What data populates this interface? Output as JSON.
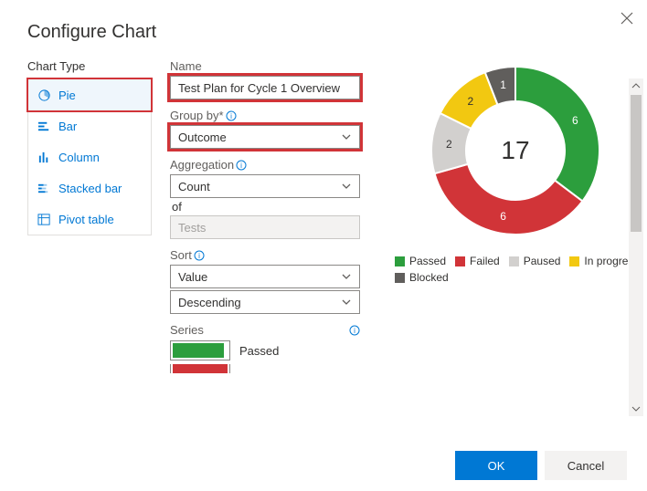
{
  "title": "Configure Chart",
  "chart_type": {
    "label": "Chart Type",
    "items": [
      "Pie",
      "Bar",
      "Column",
      "Stacked bar",
      "Pivot table"
    ],
    "selected_index": 0
  },
  "form": {
    "name_label": "Name",
    "name_value": "Test Plan for Cycle 1 Overview",
    "group_by_label": "Group by*",
    "group_by_value": "Outcome",
    "aggregation_label": "Aggregation",
    "aggregation_value": "Count",
    "of_text": "of",
    "of_value": "Tests",
    "sort_label": "Sort",
    "sort_field": "Value",
    "sort_direction": "Descending",
    "series_label": "Series",
    "series_first_name": "Passed"
  },
  "legend": [
    {
      "name": "Passed",
      "color": "#2c9e3d"
    },
    {
      "name": "Failed",
      "color": "#d13438"
    },
    {
      "name": "Paused",
      "color": "#d2d0ce"
    },
    {
      "name": "In progress",
      "color": "#f2c811"
    },
    {
      "name": "Blocked",
      "color": "#605e5c"
    }
  ],
  "chart_data": {
    "type": "pie",
    "title": "Test Plan for Cycle 1 Overview",
    "total": 17,
    "series": [
      {
        "name": "Passed",
        "value": 6,
        "color": "#2c9e3d"
      },
      {
        "name": "Failed",
        "value": 6,
        "color": "#d13438"
      },
      {
        "name": "Paused",
        "value": 2,
        "color": "#d2d0ce"
      },
      {
        "name": "In progress",
        "value": 2,
        "color": "#f2c811"
      },
      {
        "name": "Blocked",
        "value": 1,
        "color": "#605e5c"
      }
    ]
  },
  "buttons": {
    "ok": "OK",
    "cancel": "Cancel"
  }
}
